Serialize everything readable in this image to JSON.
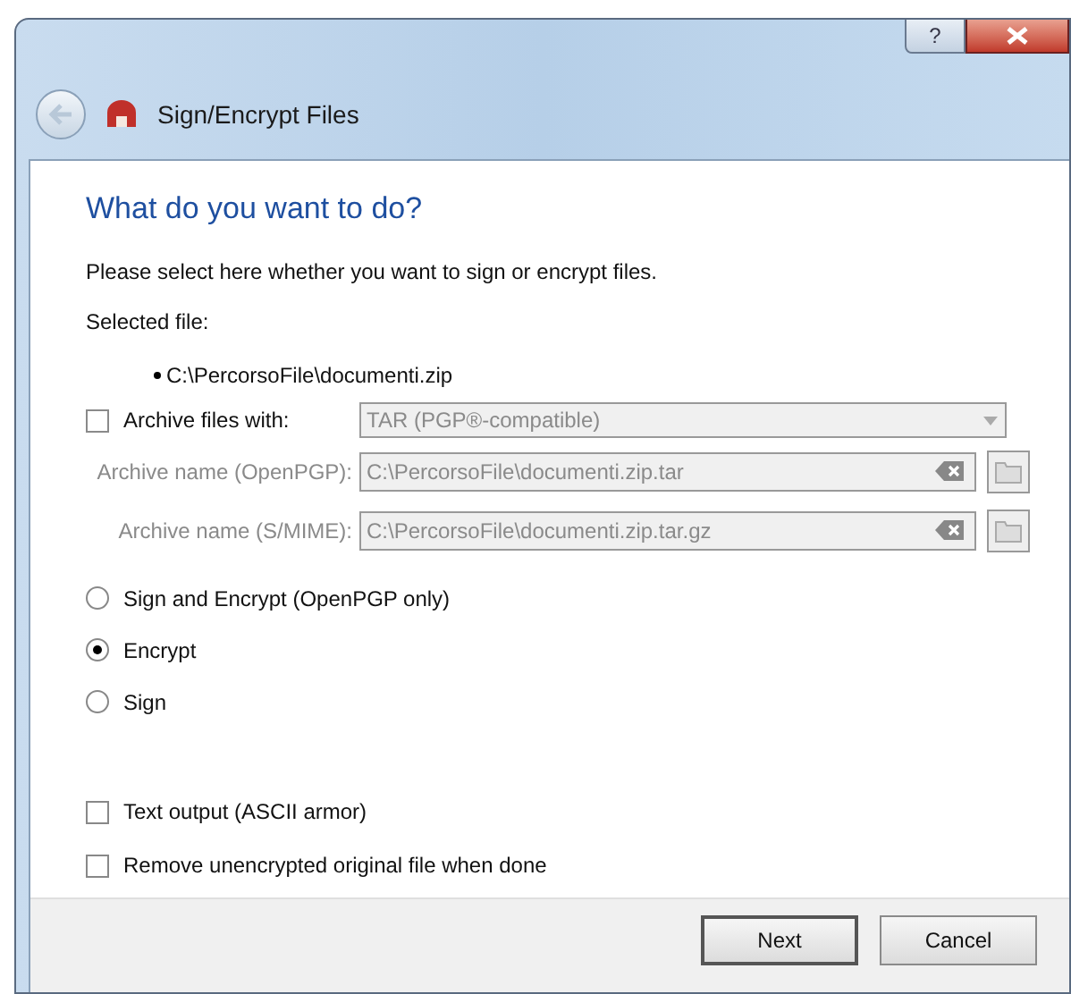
{
  "window": {
    "title": "Sign/Encrypt Files",
    "help_button": "?"
  },
  "heading": "What do you want to do?",
  "intro": "Please select here whether you want to sign or encrypt files.",
  "selected_file_label": "Selected file:",
  "selected_files": [
    "C:\\PercorsoFile\\documenti.zip"
  ],
  "archive": {
    "label": "Archive files with:",
    "checked": false,
    "format": "TAR (PGP®-compatible)"
  },
  "archive_names": [
    {
      "label": "Archive name (OpenPGP):",
      "value": "C:\\PercorsoFile\\documenti.zip.tar",
      "disabled": true
    },
    {
      "label": "Archive name (S/MIME):",
      "value": "C:\\PercorsoFile\\documenti.zip.tar.gz",
      "disabled": true
    }
  ],
  "operations": [
    {
      "label": "Sign and Encrypt (OpenPGP only)",
      "selected": false
    },
    {
      "label": "Encrypt",
      "selected": true
    },
    {
      "label": "Sign",
      "selected": false
    }
  ],
  "options": [
    {
      "label": "Text output (ASCII armor)",
      "checked": false
    },
    {
      "label": "Remove unencrypted original file when done",
      "checked": false
    }
  ],
  "buttons": [
    {
      "label": "Next",
      "default": true
    },
    {
      "label": "Cancel",
      "default": false
    }
  ]
}
